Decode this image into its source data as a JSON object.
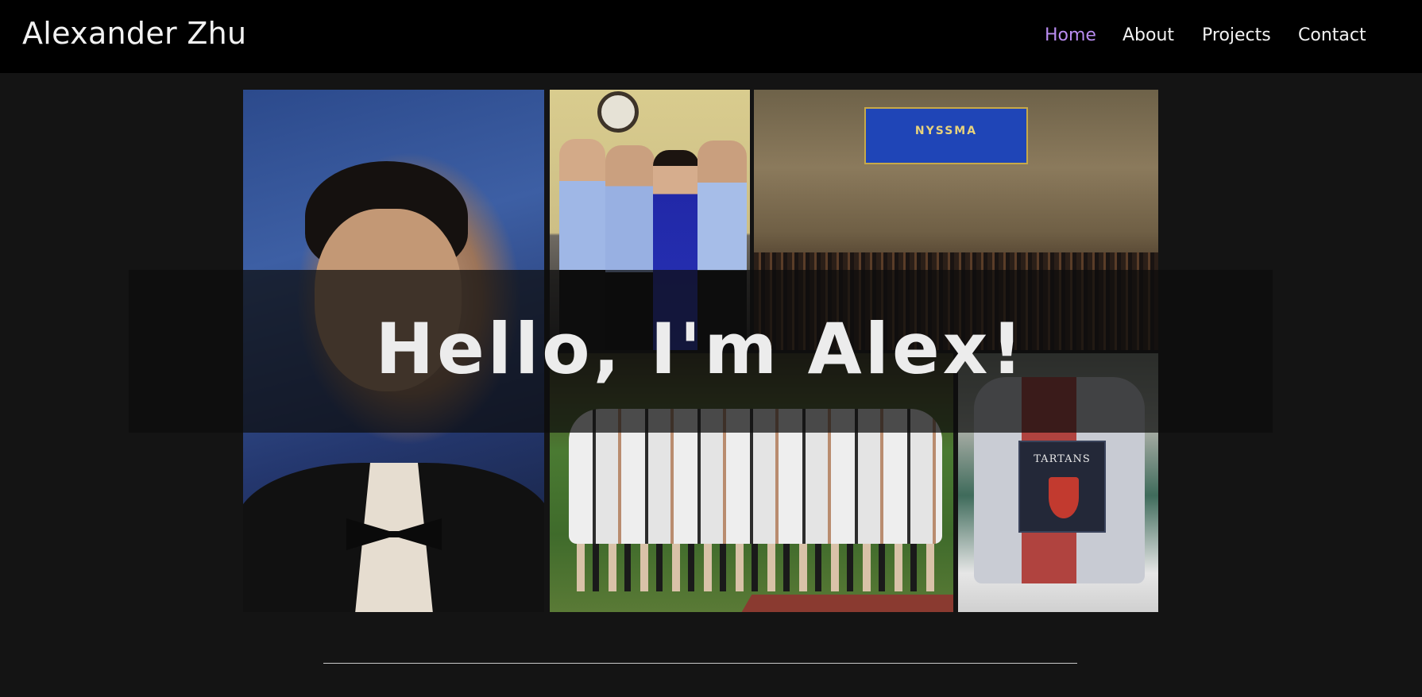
{
  "header": {
    "site_title": "Alexander Zhu",
    "nav": [
      {
        "label": "Home",
        "active": true
      },
      {
        "label": "About",
        "active": false
      },
      {
        "label": "Projects",
        "active": false
      },
      {
        "label": "Contact",
        "active": false
      }
    ]
  },
  "hero": {
    "headline": "Hello, I'm Alex!",
    "photos": {
      "portrait": {},
      "family": {},
      "concert_hall": {
        "banner_text": "NYSSMA"
      },
      "soccer_team": {},
      "tartans": {
        "flag_text": "TARTANS"
      }
    }
  },
  "colors": {
    "header_bg": "#000000",
    "page_bg": "#141414",
    "nav_active": "#b98cf0",
    "text": "#f2f2f2"
  }
}
